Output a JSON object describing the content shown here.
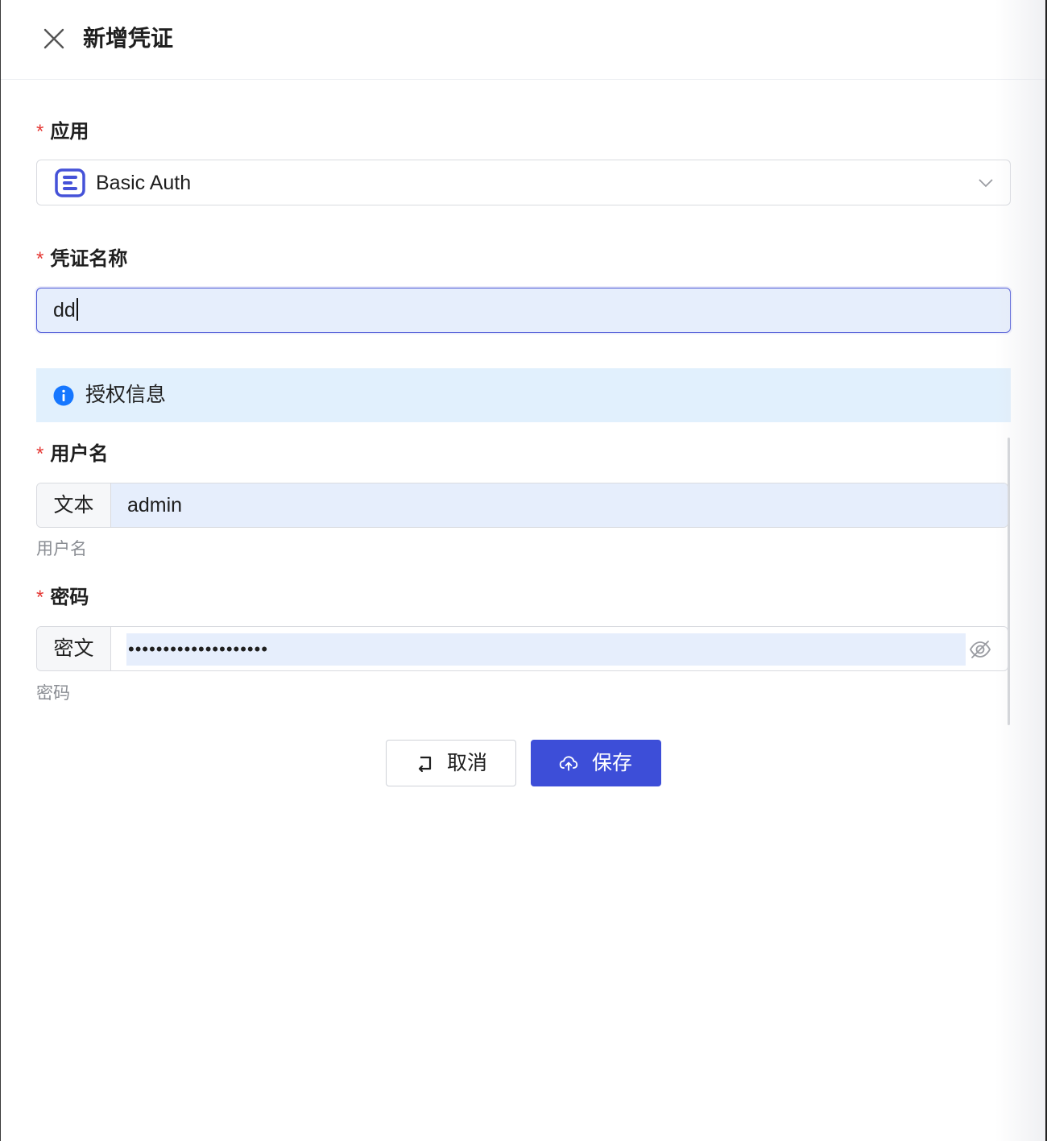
{
  "header": {
    "title": "新增凭证"
  },
  "form": {
    "app": {
      "required_mark": "*",
      "label": "应用",
      "value": "Basic Auth"
    },
    "credential_name": {
      "required_mark": "*",
      "label": "凭证名称",
      "value": "dd"
    },
    "auth_section": {
      "title": "授权信息"
    },
    "username": {
      "required_mark": "*",
      "label": "用户名",
      "type_addon": "文本",
      "value": "admin",
      "help": "用户名"
    },
    "password": {
      "required_mark": "*",
      "label": "密码",
      "type_addon": "密文",
      "masked_value": "••••••••••••••••••••",
      "help": "密码"
    }
  },
  "actions": {
    "cancel_label": "取消",
    "save_label": "保存"
  },
  "colors": {
    "primary": "#3d4ed8",
    "required": "#e53935",
    "info_bg": "#e1f0fd",
    "info_icon": "#1677ff",
    "input_fill": "#e6eefc"
  },
  "icons": {
    "close": "close-icon",
    "app": "basic-auth-app-icon",
    "dropdown": "chevron-down-icon",
    "info": "info-icon",
    "visibility": "eye-slash-icon",
    "cancel": "return-icon",
    "save": "cloud-upload-icon"
  }
}
